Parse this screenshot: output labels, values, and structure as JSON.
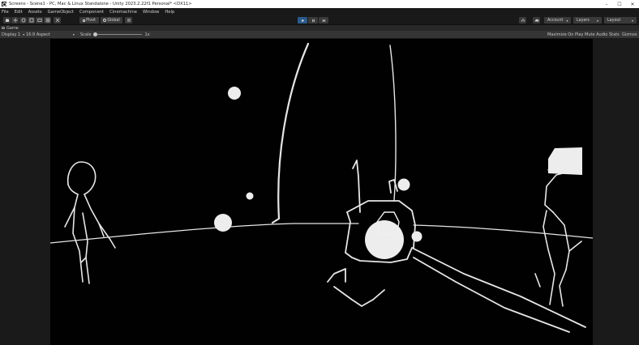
{
  "window": {
    "title": "Screens - Scene1 - PC, Mac & Linux Standalone - Unity 2023.2.22f1 Personal* <DX11>",
    "controls": [
      "–",
      "☐",
      "✕"
    ]
  },
  "menu": [
    "File",
    "Edit",
    "Assets",
    "GameObject",
    "Component",
    "Cinemachine",
    "Window",
    "Help"
  ],
  "toolbar": {
    "pivot_label": "Pivot",
    "global_label": "Global",
    "account_label": "Account",
    "layers_label": "Layers",
    "layout_label": "Layout",
    "play_active": true
  },
  "tabs": [
    {
      "label": "Game"
    }
  ],
  "game_toolbar": {
    "display": "Display 1",
    "aspect": "16:9 Aspect",
    "scale_label": "Scale",
    "scale_value": "1x",
    "maximize": "Maximize On Play",
    "mute": "Mute Audio",
    "stats": "Stats",
    "gizmos": "Gizmos"
  },
  "colors": {
    "play_accent": "#2a5b8a",
    "editor_bg": "#191919",
    "titlebar_bg": "#ffffff",
    "game_bg": "#010101"
  }
}
